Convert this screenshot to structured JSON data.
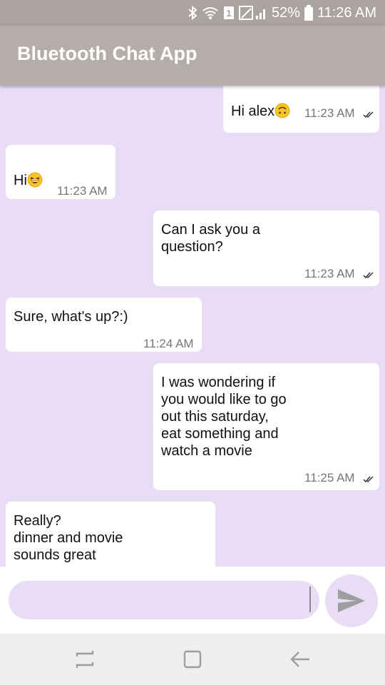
{
  "status_bar": {
    "battery": "52%",
    "time": "11:26 AM",
    "sim_badge": "1",
    "icons": [
      "bluetooth-icon",
      "wifi-icon",
      "sim-icon",
      "signal-icon",
      "battery-icon"
    ]
  },
  "app_bar": {
    "title": "Bluetooth Chat App"
  },
  "messages": [
    {
      "direction": "outgoing",
      "text": "Hi alex",
      "emoji": "upside-down-face",
      "time": "11:23 AM",
      "read": true
    },
    {
      "direction": "incoming",
      "text": "Hi",
      "emoji": "grinning-squinting-face",
      "time": "11:23 AM"
    },
    {
      "direction": "outgoing",
      "text": "Can I ask you a\nquestion?",
      "time": "11:23 AM",
      "read": true
    },
    {
      "direction": "incoming",
      "text": "Sure, what's up?:)",
      "time": "11:24 AM"
    },
    {
      "direction": "outgoing",
      "text": "I was wondering if\nyou would like to go\nout this saturday,\neat something and\nwatch a movie",
      "time": "11:25 AM",
      "read": true
    },
    {
      "direction": "incoming",
      "text": "Really?\ndinner and movie\nsounds great",
      "time": ""
    }
  ],
  "composer": {
    "value": "",
    "send_icon": "send-icon"
  },
  "nav_bar": {
    "icons": [
      "recents-icon",
      "home-icon",
      "back-icon"
    ]
  },
  "colors": {
    "chat_background": "#e8ddf5",
    "app_bar": "#b5adaa",
    "status_bar": "#aaa3a0",
    "bubble": "#ffffff",
    "send_icon": "#9e9e9e"
  }
}
